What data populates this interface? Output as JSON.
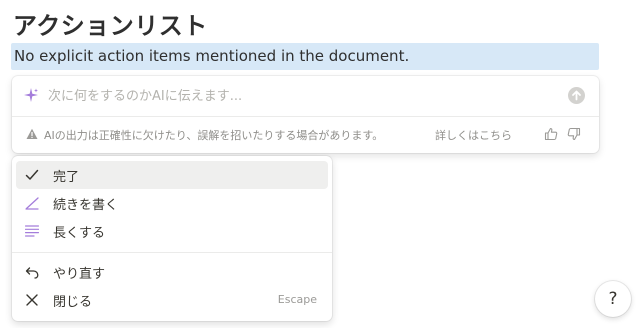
{
  "page": {
    "heading": "アクションリスト",
    "selected_text": "No explicit action items mentioned in the document."
  },
  "ai_panel": {
    "input_placeholder": "次に何をするのかAIに伝えます...",
    "input_value": "",
    "warning": "AIの出力は正確性に欠けたり、誤解を招いたりする場合があります。",
    "learn_more": "詳しくはこちら",
    "icons": {
      "sparkle": "sparkle-icon",
      "send": "arrow-up-circle-icon",
      "warning": "warning-triangle-icon",
      "thumbs_up": "thumbs-up-icon",
      "thumbs_down": "thumbs-down-icon"
    },
    "accent_color": "#a47ddb"
  },
  "menu": {
    "items": [
      {
        "label": "完了",
        "icon": "check-icon",
        "shortcut": "",
        "active": true
      },
      {
        "label": "続きを書く",
        "icon": "pencil-icon",
        "shortcut": "",
        "active": false
      },
      {
        "label": "長くする",
        "icon": "lines-icon",
        "shortcut": "",
        "active": false
      },
      {
        "label": "やり直す",
        "icon": "undo-icon",
        "shortcut": "",
        "active": false
      },
      {
        "label": "閉じる",
        "icon": "close-icon",
        "shortcut": "Escape",
        "active": false
      }
    ]
  },
  "help": {
    "label": "?"
  }
}
